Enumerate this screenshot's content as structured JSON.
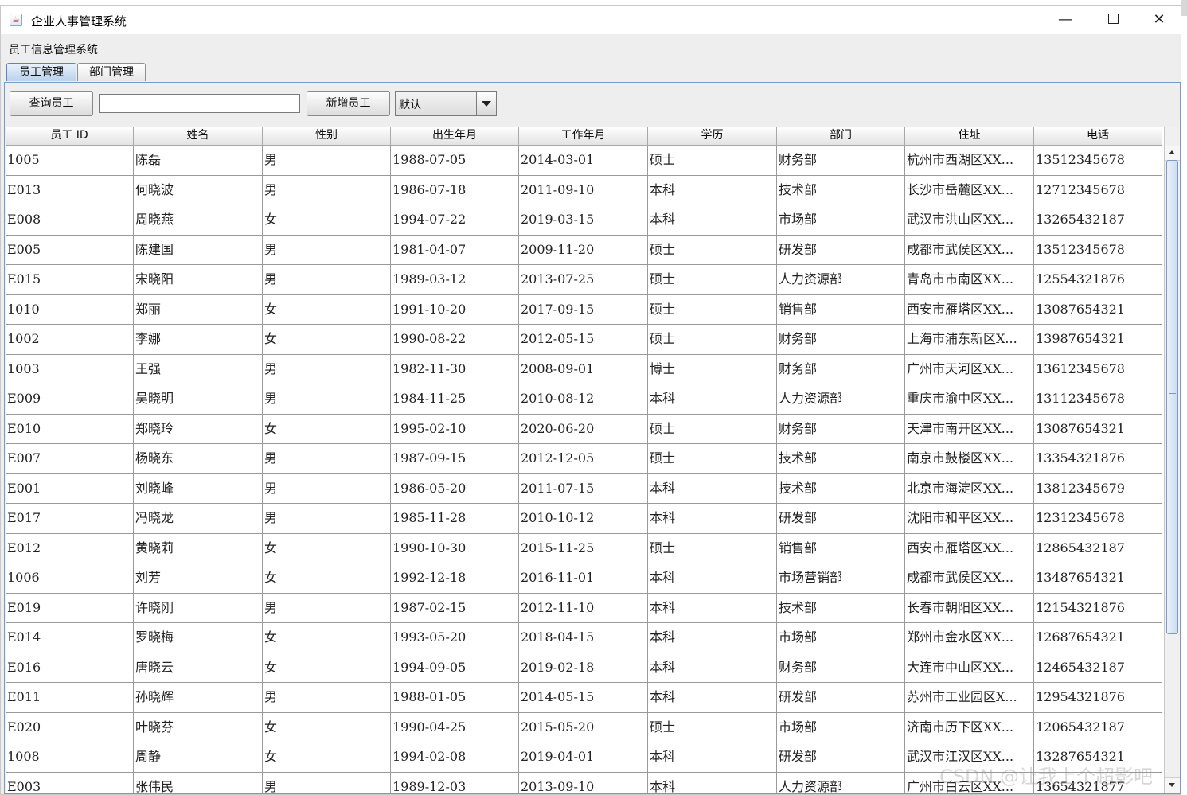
{
  "window": {
    "title": "企业人事管理系统",
    "min_glyph": "—",
    "close_glyph": "✕"
  },
  "system_label": "员工信息管理系统",
  "tabs": [
    {
      "label": "员工管理",
      "active": true
    },
    {
      "label": "部门管理",
      "active": false
    }
  ],
  "toolbar": {
    "query_label": "查询员工",
    "search_value": "",
    "add_label": "新增员工",
    "sort_selected": "默认"
  },
  "table": {
    "columns": [
      "员工 ID",
      "姓名",
      "性别",
      "出生年月",
      "工作年月",
      "学历",
      "部门",
      "住址",
      "电话"
    ],
    "rows": [
      [
        "1005",
        "陈磊",
        "男",
        "1988-07-05",
        "2014-03-01",
        "硕士",
        "财务部",
        "杭州市西湖区XX...",
        "13512345678"
      ],
      [
        "E013",
        "何晓波",
        "男",
        "1986-07-18",
        "2011-09-10",
        "本科",
        "技术部",
        "长沙市岳麓区XX...",
        "12712345678"
      ],
      [
        "E008",
        "周晓燕",
        "女",
        "1994-07-22",
        "2019-03-15",
        "本科",
        "市场部",
        "武汉市洪山区XX...",
        "13265432187"
      ],
      [
        "E005",
        "陈建国",
        "男",
        "1981-04-07",
        "2009-11-20",
        "硕士",
        "研发部",
        "成都市武侯区XX...",
        "13512345678"
      ],
      [
        "E015",
        "宋晓阳",
        "男",
        "1989-03-12",
        "2013-07-25",
        "硕士",
        "人力资源部",
        "青岛市市南区XX...",
        "12554321876"
      ],
      [
        "1010",
        "郑丽",
        "女",
        "1991-10-20",
        "2017-09-15",
        "硕士",
        "销售部",
        "西安市雁塔区XX...",
        "13087654321"
      ],
      [
        "1002",
        "李娜",
        "女",
        "1990-08-22",
        "2012-05-15",
        "硕士",
        "财务部",
        "上海市浦东新区X...",
        "13987654321"
      ],
      [
        "1003",
        "王强",
        "男",
        "1982-11-30",
        "2008-09-01",
        "博士",
        "财务部",
        "广州市天河区XX...",
        "13612345678"
      ],
      [
        "E009",
        "吴晓明",
        "男",
        "1984-11-25",
        "2010-08-12",
        "本科",
        "人力资源部",
        "重庆市渝中区XX...",
        "13112345678"
      ],
      [
        "E010",
        "郑晓玲",
        "女",
        "1995-02-10",
        "2020-06-20",
        "硕士",
        "财务部",
        "天津市南开区XX...",
        "13087654321"
      ],
      [
        "E007",
        "杨晓东",
        "男",
        "1987-09-15",
        "2012-12-05",
        "硕士",
        "技术部",
        "南京市鼓楼区XX...",
        "13354321876"
      ],
      [
        "E001",
        "刘晓峰",
        "男",
        "1986-05-20",
        "2011-07-15",
        "本科",
        "技术部",
        "北京市海淀区XX...",
        "13812345679"
      ],
      [
        "E017",
        "冯晓龙",
        "男",
        "1985-11-28",
        "2010-10-12",
        "本科",
        "研发部",
        "沈阳市和平区XX...",
        "12312345678"
      ],
      [
        "E012",
        "黄晓莉",
        "女",
        "1990-10-30",
        "2015-11-25",
        "硕士",
        "销售部",
        "西安市雁塔区XX...",
        "12865432187"
      ],
      [
        "1006",
        "刘芳",
        "女",
        "1992-12-18",
        "2016-11-01",
        "本科",
        "市场营销部",
        "成都市武侯区XX...",
        "13487654321"
      ],
      [
        "E019",
        "许晓刚",
        "男",
        "1987-02-15",
        "2012-11-10",
        "本科",
        "技术部",
        "长春市朝阳区XX...",
        "12154321876"
      ],
      [
        "E014",
        "罗晓梅",
        "女",
        "1993-05-20",
        "2018-04-15",
        "本科",
        "市场部",
        "郑州市金水区XX...",
        "12687654321"
      ],
      [
        "E016",
        "唐晓云",
        "女",
        "1994-09-05",
        "2019-02-18",
        "本科",
        "财务部",
        "大连市中山区XX...",
        "12465432187"
      ],
      [
        "E011",
        "孙晓辉",
        "男",
        "1988-01-05",
        "2014-05-15",
        "本科",
        "研发部",
        "苏州市工业园区X...",
        "12954321876"
      ],
      [
        "E020",
        "叶晓芬",
        "女",
        "1990-04-25",
        "2015-05-20",
        "硕士",
        "市场部",
        "济南市历下区XX...",
        "12065432187"
      ],
      [
        "1008",
        "周静",
        "女",
        "1994-02-08",
        "2019-04-01",
        "本科",
        "研发部",
        "武汉市江汉区XX...",
        "13287654321"
      ],
      [
        "E003",
        "张伟民",
        "男",
        "1989-12-03",
        "2013-09-10",
        "本科",
        "人力资源部",
        "广州市白云区XX...",
        "13654321877"
      ]
    ]
  },
  "watermark": "CSDN @让我上个超影吧"
}
